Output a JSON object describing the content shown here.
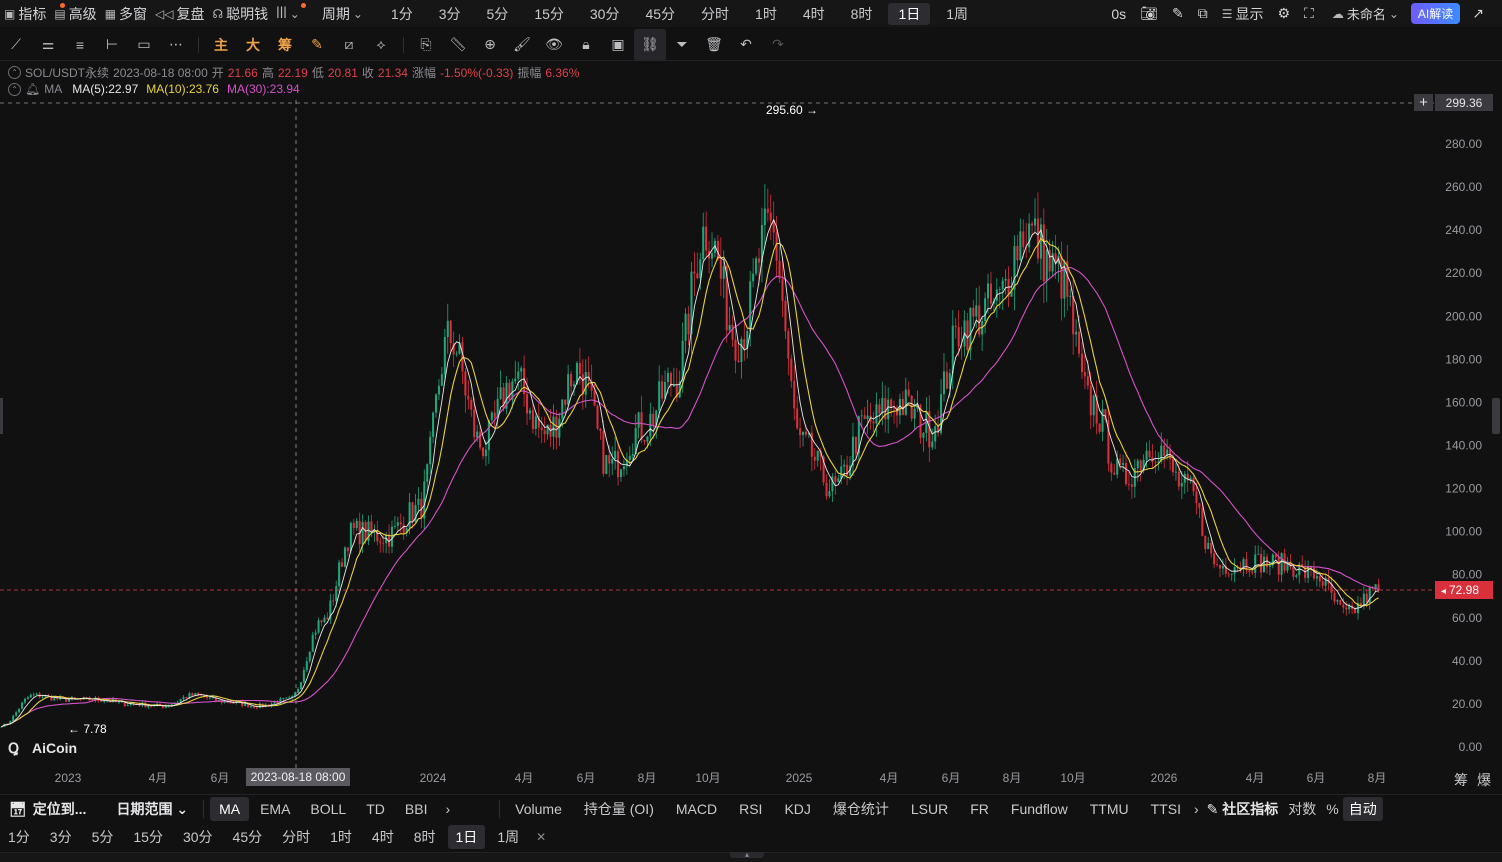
{
  "topbar": {
    "indicators": "指标",
    "advanced": "高级",
    "multi_window": "多窗",
    "replay": "复盘",
    "smart_money": "聪明钱",
    "cycle": "周期",
    "periods": [
      "1分",
      "3分",
      "5分",
      "15分",
      "30分",
      "45分",
      "分时",
      "1时",
      "4时",
      "8时",
      "1日",
      "1周"
    ],
    "active_period": "1日",
    "countdown": "0s",
    "display": "显示",
    "layout_name": "未命名",
    "ai_button": "AI解读"
  },
  "tools": {
    "main": "主",
    "big": "大",
    "chips": "筹"
  },
  "info": {
    "symbol": "SOL/USDT永续",
    "datetime": "2023-08-18 08:00",
    "open_label": "开",
    "open": "21.66",
    "high_label": "高",
    "high": "22.19",
    "low_label": "低",
    "low": "20.81",
    "close_label": "收",
    "close": "21.34",
    "change_label": "涨幅",
    "change": "-1.50%(-0.33)",
    "amp_label": "振幅",
    "amp": "6.36%",
    "ma_name": "MA",
    "ma5": "MA(5):22.97",
    "ma10": "MA(10):23.76",
    "ma30": "MA(30):23.94"
  },
  "chart_data": {
    "type": "candlestick",
    "price_axis": [
      "299.36",
      "280.00",
      "260.00",
      "240.00",
      "220.00",
      "200.00",
      "180.00",
      "160.00",
      "140.00",
      "120.00",
      "100.00",
      "80.00",
      "72.98",
      "60.00",
      "40.00",
      "20.00",
      "0.00"
    ],
    "ylim": [
      0,
      299.36
    ],
    "time_axis": [
      "2023",
      "4月",
      "6月",
      "2023-08-18 08:00",
      "2024",
      "4月",
      "6月",
      "8月",
      "10月",
      "2025",
      "4月",
      "6月",
      "8月",
      "10月",
      "2026",
      "4月",
      "6月",
      "8月"
    ],
    "crosshair_price": "299.36",
    "crosshair_time": "2023-08-18 08:00",
    "current_price": "72.98",
    "max_label": "295.60",
    "min_label": "7.78",
    "watermark": "AiCoin",
    "axis_corner": [
      "筹",
      "爆"
    ],
    "series": [
      {
        "name": "MA(5)",
        "color": "#e9e9e9"
      },
      {
        "name": "MA(10)",
        "color": "#e8d13a"
      },
      {
        "name": "MA(30)",
        "color": "#d452c8"
      }
    ],
    "close_series": {
      "x": [
        "2023-01",
        "2023-02",
        "2023-03",
        "2023-04",
        "2023-05",
        "2023-06",
        "2023-07",
        "2023-08",
        "2023-09",
        "2023-10",
        "2023-11",
        "2023-12",
        "2024-01",
        "2024-02",
        "2024-03",
        "2024-04",
        "2024-05",
        "2024-06",
        "2024-07",
        "2024-08",
        "2024-09",
        "2024-10",
        "2024-11",
        "2024-12",
        "2025-01",
        "2025-02",
        "2025-03",
        "2025-04",
        "2025-05",
        "2025-06",
        "2025-07",
        "2025-08",
        "2025-09",
        "2025-10",
        "2025-11",
        "2025-12",
        "2026-01",
        "2026-02",
        "2026-03",
        "2026-04",
        "2026-05",
        "2026-06",
        "2026-07",
        "2026-08"
      ],
      "y": [
        10,
        24,
        22,
        22,
        20,
        19,
        24,
        21,
        19,
        22,
        58,
        100,
        98,
        110,
        190,
        140,
        170,
        145,
        175,
        130,
        148,
        170,
        240,
        190,
        240,
        140,
        120,
        150,
        160,
        148,
        195,
        205,
        240,
        220,
        160,
        125,
        140,
        120,
        84,
        86,
        85,
        80,
        62,
        73
      ]
    }
  },
  "bottom": {
    "locate": "定位到...",
    "date_range": "日期范围",
    "main_indicators": [
      "MA",
      "EMA",
      "BOLL",
      "TD",
      "BBI"
    ],
    "sub_indicators": [
      "Volume",
      "持仓量 (OI)",
      "MACD",
      "RSI",
      "KDJ",
      "爆仓统计",
      "LSUR",
      "FR",
      "Fundflow",
      "TTMU",
      "TTSI"
    ],
    "community": "社区指标",
    "log": "对数",
    "percent": "%",
    "auto": "自动"
  },
  "periods2": [
    "1分",
    "3分",
    "5分",
    "15分",
    "30分",
    "45分",
    "分时",
    "1时",
    "4时",
    "8时",
    "1日",
    "1周"
  ],
  "active_period2": "1日"
}
